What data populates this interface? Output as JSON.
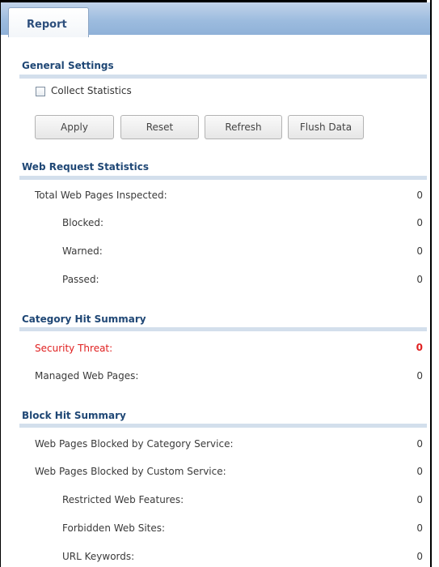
{
  "tab": {
    "label": "Report"
  },
  "general": {
    "title": "General Settings",
    "collect_label": "Collect Statistics",
    "collect_checked": false,
    "buttons": {
      "apply": "Apply",
      "reset": "Reset",
      "refresh": "Refresh",
      "flush": "Flush Data"
    }
  },
  "web_request": {
    "title": "Web Request Statistics",
    "rows": [
      {
        "label": "Total Web Pages Inspected:",
        "value": "0"
      },
      {
        "label": "Blocked:",
        "value": "0"
      },
      {
        "label": "Warned:",
        "value": "0"
      },
      {
        "label": "Passed:",
        "value": "0"
      }
    ]
  },
  "category_hit": {
    "title": "Category Hit Summary",
    "rows": [
      {
        "label": "Security Threat:",
        "value": "0"
      },
      {
        "label": "Managed Web Pages:",
        "value": "0"
      }
    ]
  },
  "block_hit": {
    "title": "Block Hit Summary",
    "rows": [
      {
        "label": "Web Pages Blocked by Category Service:",
        "value": "0"
      },
      {
        "label": "Web Pages Blocked by Custom Service:",
        "value": "0"
      },
      {
        "label": "Restricted Web Features:",
        "value": "0"
      },
      {
        "label": "Forbidden Web Sites:",
        "value": "0"
      },
      {
        "label": "URL Keywords:",
        "value": "0"
      }
    ]
  },
  "colors": {
    "threat": "#e02020",
    "header": "#9dbcdf",
    "section_title": "#1f4775"
  }
}
